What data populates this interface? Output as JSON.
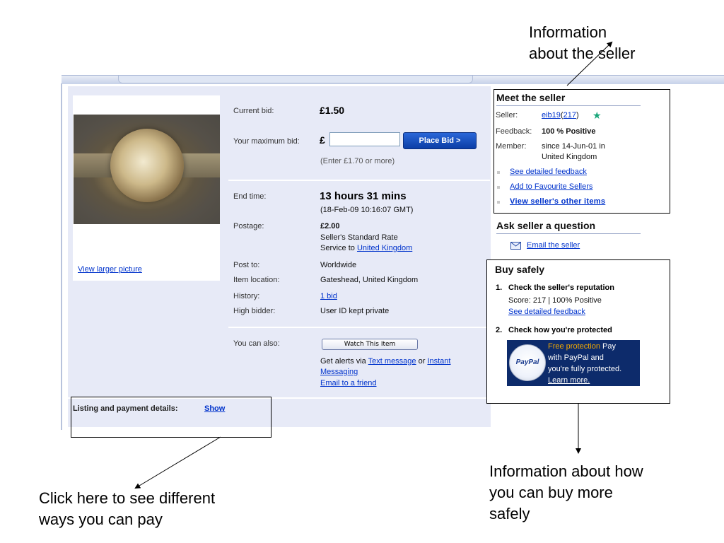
{
  "annotations": {
    "seller_info_line1": "Information",
    "seller_info_line2": "about the seller",
    "buy_safely_line1": "Information about how",
    "buy_safely_line2": "you can buy more",
    "buy_safely_line3": "safely",
    "payment_line1": "Click here to see different",
    "payment_line2": "ways you can pay"
  },
  "listing": {
    "view_larger_picture": "View larger picture",
    "current_bid_label": "Current bid:",
    "current_bid_value": "£1.50",
    "max_bid_label": "Your maximum bid:",
    "currency_symbol": "£",
    "bid_input_value": "",
    "place_bid_button": "Place Bid >",
    "enter_hint": "(Enter £1.70 or more)",
    "end_time_label": "End time:",
    "end_time_value": "13 hours 31 mins",
    "end_time_date": "(18-Feb-09 10:16:07 GMT)",
    "postage_label": "Postage:",
    "postage_value": "£2.00",
    "postage_rate": "Seller's Standard Rate",
    "postage_service_prefix": "Service to",
    "postage_service_link": "United Kingdom",
    "post_to_label": "Post to:",
    "post_to_value": "Worldwide",
    "item_location_label": "Item location:",
    "item_location_value": "Gateshead, United Kingdom",
    "history_label": "History:",
    "history_value": "1 bid",
    "high_bidder_label": "High bidder:",
    "high_bidder_value": "User ID kept private",
    "you_can_also_label": "You can also:",
    "watch_button": "Watch This Item",
    "alerts_prefix": "Get alerts via",
    "alerts_text_link": "Text message",
    "alerts_or": "or",
    "alerts_im_link_1": "Instant",
    "alerts_im_link_2": "Messaging",
    "email_friend": "Email to a friend",
    "listing_payment_label": "Listing and payment details:",
    "show_link": "Show"
  },
  "seller": {
    "title": "Meet the seller",
    "seller_label": "Seller:",
    "seller_name": "eib19",
    "seller_paren_open": "(",
    "seller_score": "217",
    "seller_paren_close": ")",
    "feedback_label": "Feedback:",
    "feedback_value": "100 % Positive",
    "member_label": "Member:",
    "member_value_1": "since 14-Jun-01 in",
    "member_value_2": "United Kingdom",
    "link_feedback": "See detailed feedback",
    "link_favourite": "Add to Favourite Sellers",
    "link_other_items": "View seller's other items"
  },
  "ask": {
    "title": "Ask seller a question",
    "email_link": "Email the seller"
  },
  "buysafe": {
    "title": "Buy safely",
    "step1_num": "1.",
    "step1_title": "Check the seller's reputation",
    "step1_score": "Score: 217 | 100% Positive",
    "step1_link": "See detailed feedback",
    "step2_num": "2.",
    "step2_title": "Check how you're protected",
    "paypal_logo": "PayPal",
    "paypal_highlight": "Free protection",
    "paypal_line1_rest": "Pay",
    "paypal_line2": "with PayPal and",
    "paypal_line3": "you're fully protected.",
    "paypal_learn": "Learn more."
  },
  "colors": {
    "accent": "#0033cc",
    "panel": "#e7eaf7",
    "paypal_bg": "#0d2b6b",
    "paypal_highlight": "#f2a900"
  }
}
